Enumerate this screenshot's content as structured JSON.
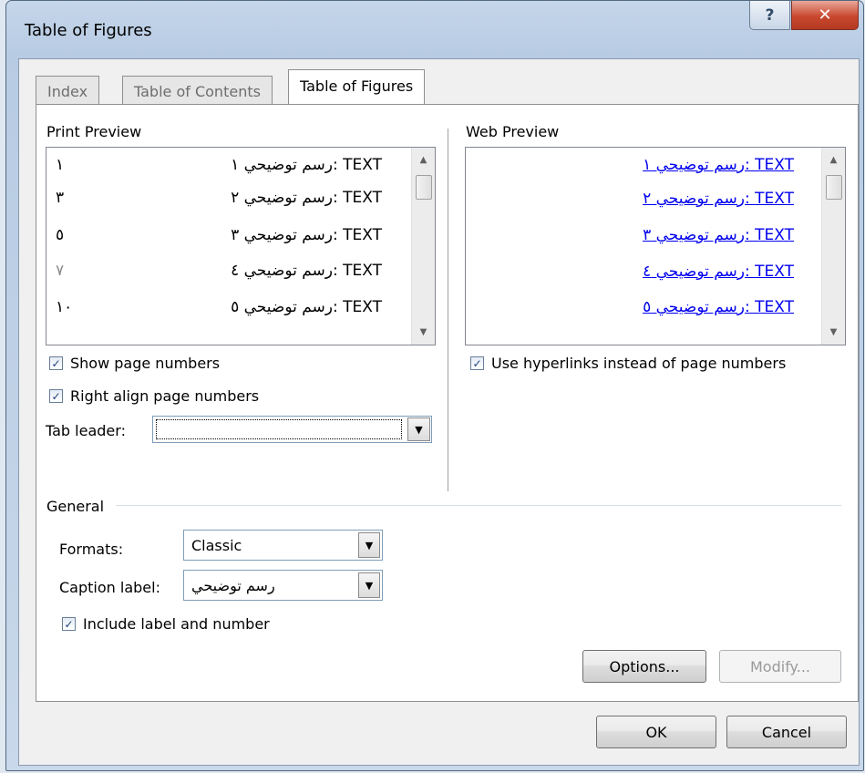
{
  "window": {
    "title": "Table of Figures"
  },
  "tabs": [
    "Index",
    "Table of Contents",
    "Table of Figures"
  ],
  "print_preview": {
    "label": "Print Preview",
    "entries": [
      {
        "caption": "رسم توضيحي ١: TEXT",
        "page": "١"
      },
      {
        "caption": "رسم توضيحي ٢: TEXT",
        "page": "٣"
      },
      {
        "caption": "رسم توضيحي ٣: TEXT",
        "page": "٥"
      },
      {
        "caption": "رسم توضيحي ٤: TEXT",
        "page": "٧"
      },
      {
        "caption": "رسم توضيحي ٥: TEXT",
        "page": "١٠"
      }
    ]
  },
  "web_preview": {
    "label": "Web Preview",
    "entries": [
      "رسم توضيحي ١: TEXT",
      "رسم توضيحي ٢: TEXT",
      "رسم توضيحي ٣: TEXT",
      "رسم توضيحي ٤: TEXT",
      "رسم توضيحي ٥: TEXT"
    ]
  },
  "options": {
    "show_page_numbers": {
      "label": "Show page numbers",
      "checked": true
    },
    "right_align": {
      "label": "Right align page numbers",
      "checked": true
    },
    "use_hyperlinks": {
      "label": "Use hyperlinks instead of page numbers",
      "checked": true
    },
    "tab_leader_label": "Tab leader:"
  },
  "general": {
    "label": "General",
    "formats_label": "Formats:",
    "formats_value": "Classic",
    "caption_label": "Caption label:",
    "caption_value": "رسم توضيحي",
    "include_label": {
      "label": "Include label and number",
      "checked": true
    }
  },
  "buttons": {
    "options": "Options...",
    "modify": "Modify...",
    "ok": "OK",
    "cancel": "Cancel"
  }
}
